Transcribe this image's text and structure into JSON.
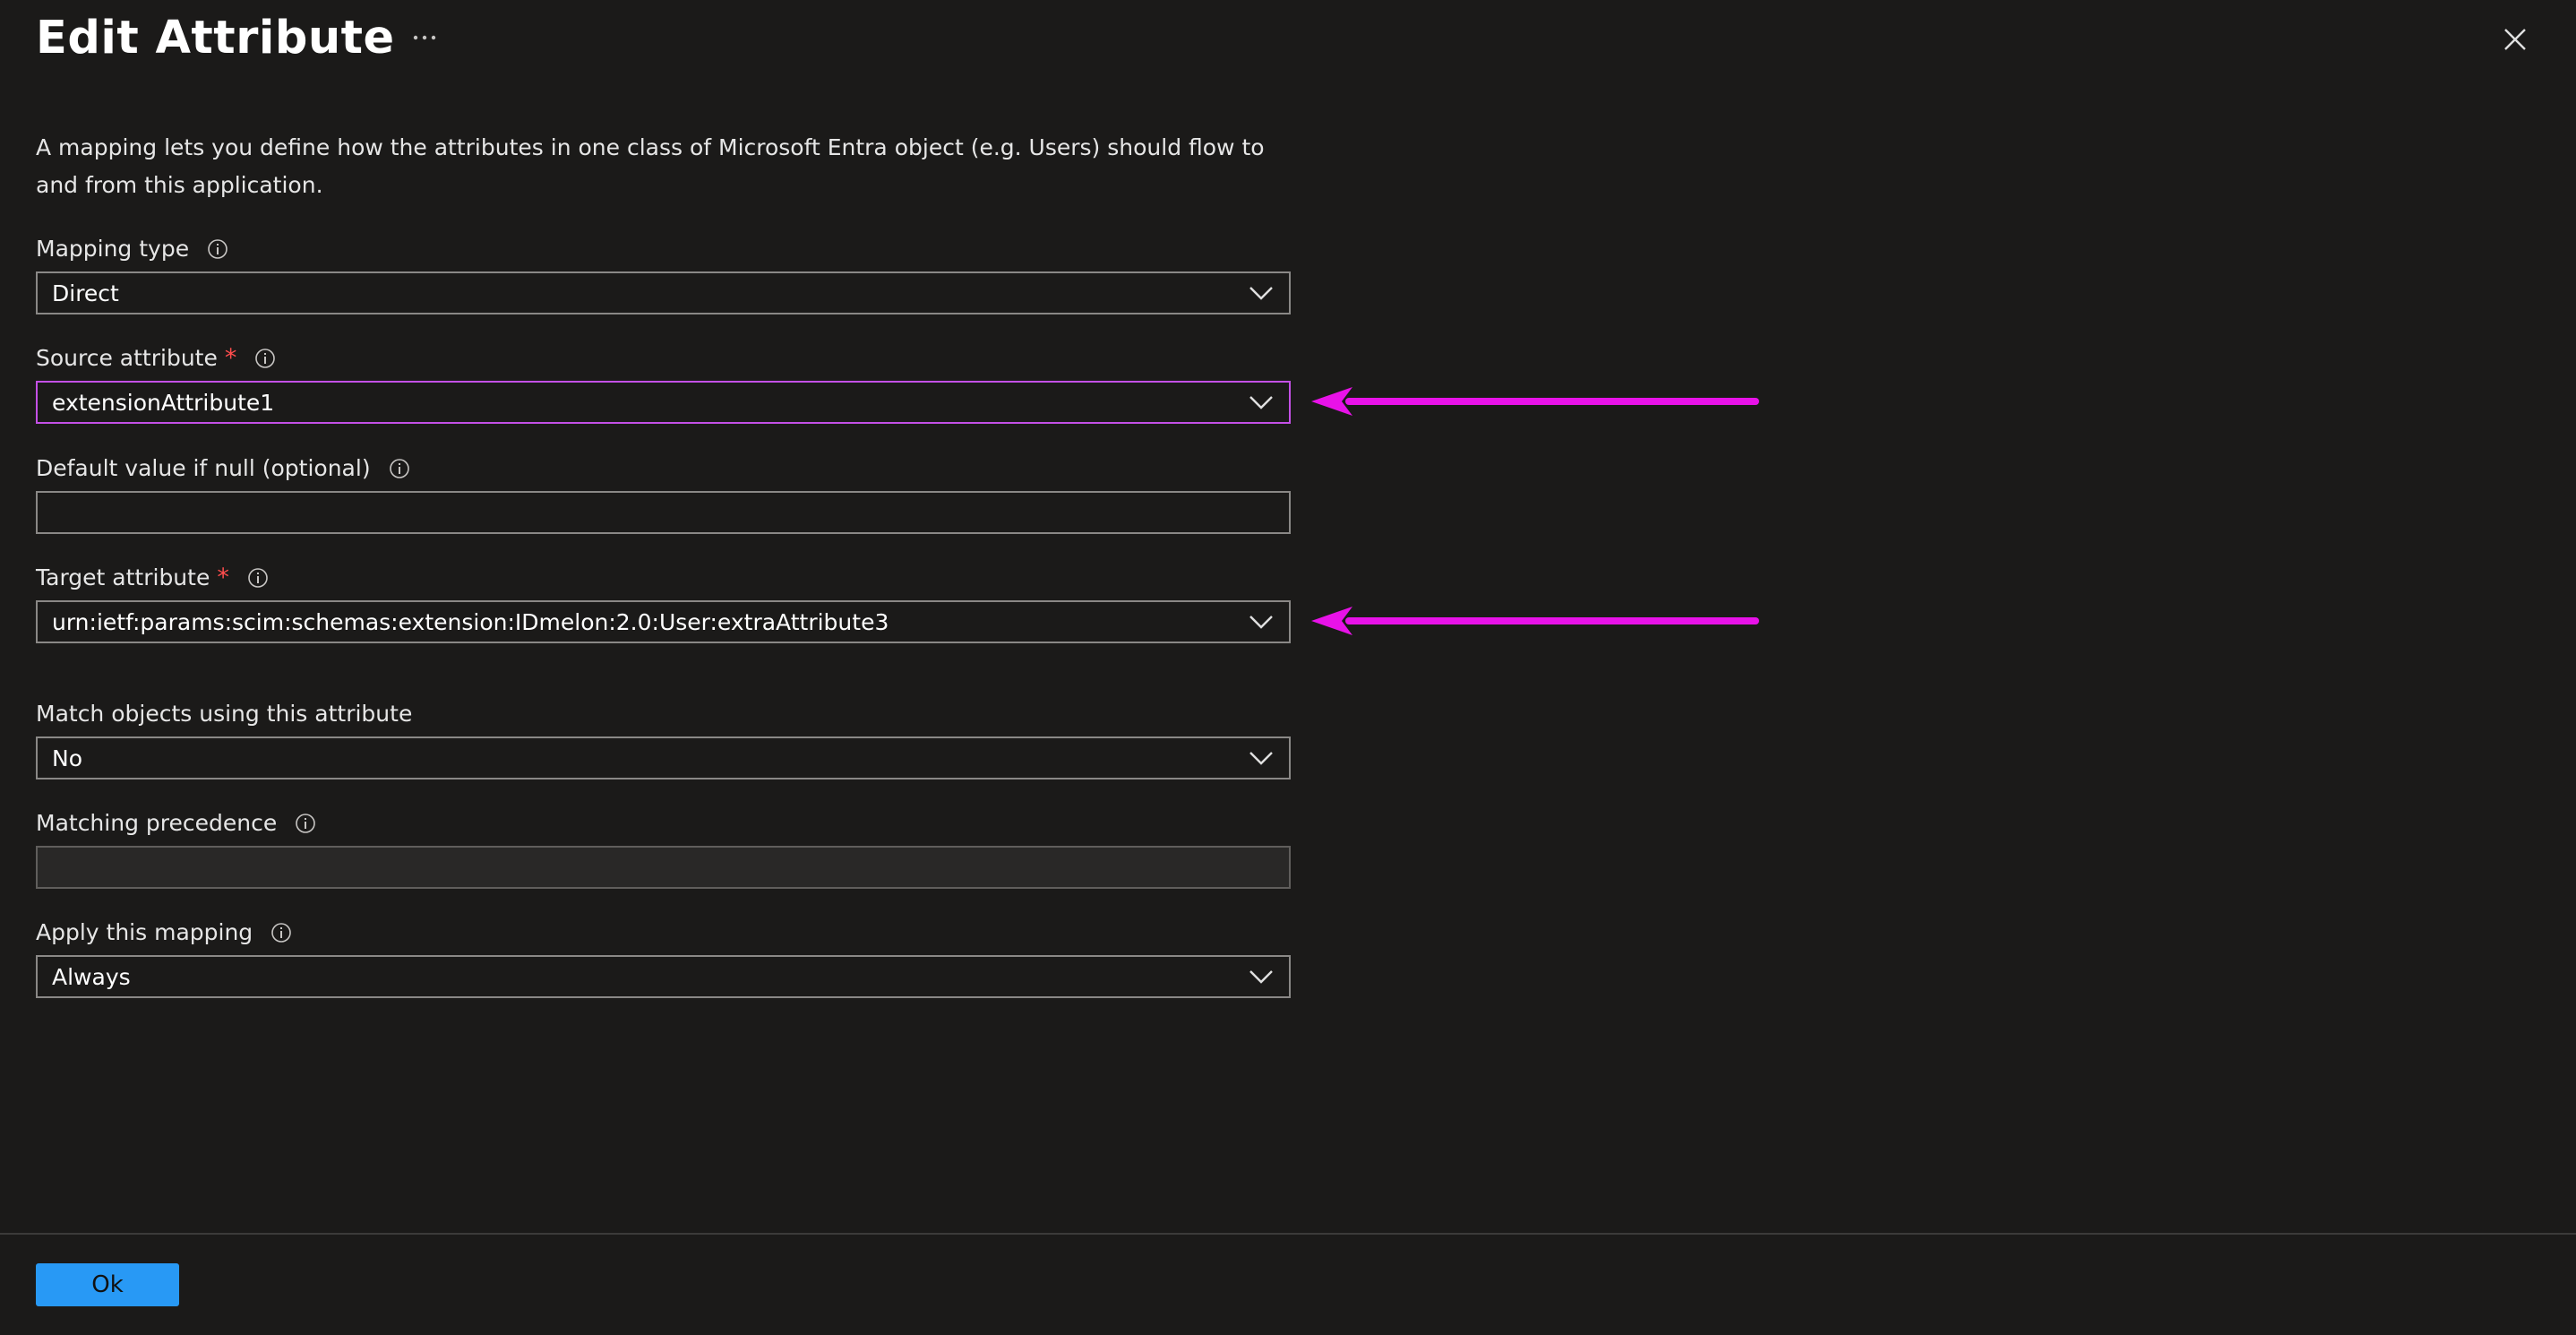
{
  "panel": {
    "title": "Edit Attribute",
    "more_icon": "ellipsis-icon",
    "close_icon": "close-icon"
  },
  "description": "A mapping lets you define how the attributes in one class of Microsoft Entra object (e.g. Users) should flow to and from this application.",
  "fields": {
    "mapping_type": {
      "label": "Mapping type",
      "value": "Direct"
    },
    "source_attribute": {
      "label": "Source attribute",
      "required_mark": "*",
      "value": "extensionAttribute1"
    },
    "default_value": {
      "label": "Default value if null (optional)",
      "value": ""
    },
    "target_attribute": {
      "label": "Target attribute",
      "required_mark": "*",
      "value": "urn:ietf:params:scim:schemas:extension:IDmelon:2.0:User:extraAttribute3"
    },
    "match_objects": {
      "label": "Match objects using this attribute",
      "value": "No"
    },
    "matching_precedence": {
      "label": "Matching precedence",
      "value": ""
    },
    "apply_mapping": {
      "label": "Apply this mapping",
      "value": "Always"
    }
  },
  "footer": {
    "ok_label": "Ok"
  },
  "colors": {
    "background": "#1b1a19",
    "accent": "#2899f5",
    "annotation_arrow": "#e812e8",
    "required": "#ff4d4d",
    "highlight_border": "#c450e6"
  }
}
